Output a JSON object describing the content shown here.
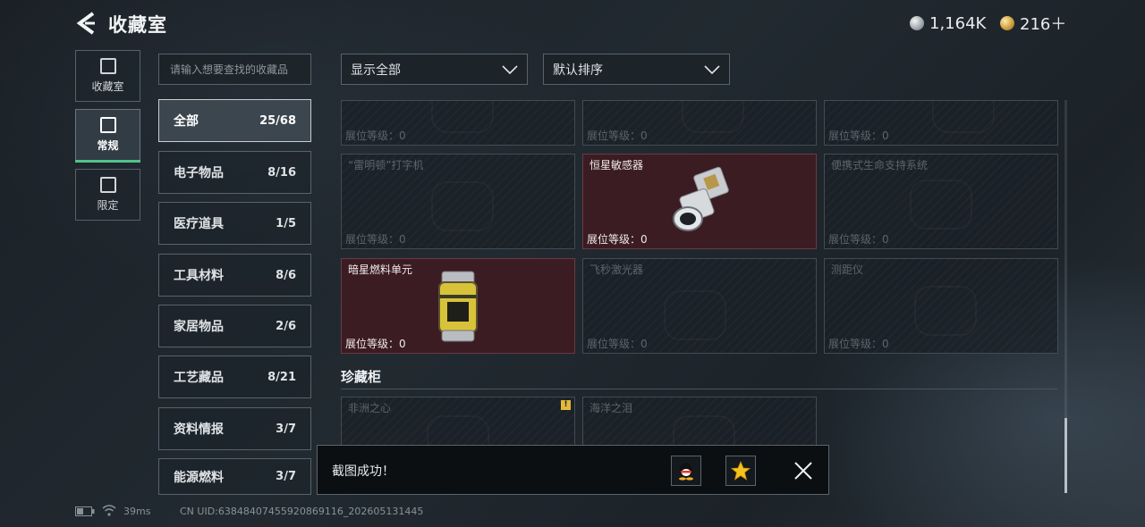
{
  "header": {
    "title": "收藏室",
    "currency_silver": "1,164K",
    "currency_gold": "216＋"
  },
  "side_tabs": [
    {
      "label": "收藏室",
      "icon": "collection-icon",
      "active": false
    },
    {
      "label": "常规",
      "icon": "regular-icon",
      "active": true
    },
    {
      "label": "限定",
      "icon": "limited-icon",
      "active": false
    }
  ],
  "search": {
    "placeholder": "请输入想要查找的收藏品"
  },
  "categories": [
    {
      "label": "全部",
      "count": "25/68",
      "active": true
    },
    {
      "label": "电子物品",
      "count": "8/16"
    },
    {
      "label": "医疗道具",
      "count": "1/5"
    },
    {
      "label": "工具材料",
      "count": "8/6"
    },
    {
      "label": "家居物品",
      "count": "2/6"
    },
    {
      "label": "工艺藏品",
      "count": "8/21"
    },
    {
      "label": "资料情报",
      "count": "3/7"
    },
    {
      "label": "能源燃料",
      "count": "3/7"
    }
  ],
  "filters": {
    "display": "显示全部",
    "sort": "默认排序"
  },
  "grid": {
    "row1": [
      {
        "name": "",
        "level": "展位等级：0",
        "owned": false
      },
      {
        "name": "",
        "level": "展位等级：0",
        "owned": false
      },
      {
        "name": "",
        "level": "展位等级：0",
        "owned": false
      }
    ],
    "row2": [
      {
        "name": "“雷明顿”打字机",
        "level": "展位等级：0",
        "owned": false
      },
      {
        "name": "恒星敏感器",
        "level": "展位等级：0",
        "owned": true
      },
      {
        "name": "便携式生命支持系统",
        "level": "展位等级：0",
        "owned": false
      }
    ],
    "row3": [
      {
        "name": "暗星燃料单元",
        "level": "展位等级：0",
        "owned": true
      },
      {
        "name": "飞秒激光器",
        "level": "展位等级：0",
        "owned": false
      },
      {
        "name": "测距仪",
        "level": "展位等级：0",
        "owned": false
      }
    ]
  },
  "treasure": {
    "section_title": "珍藏柜",
    "items": [
      {
        "name": "非洲之心",
        "badge": "!"
      },
      {
        "name": "海洋之泪"
      }
    ]
  },
  "toast": {
    "message": "截图成功！"
  },
  "status_bar": {
    "ping": "39ms",
    "uid": "CN UID:638484074559208691​16_202605131445"
  },
  "colors": {
    "accent_green": "#4fc58a",
    "owned_bg": "#3b1c22",
    "badge_yellow": "#e4b83a"
  }
}
